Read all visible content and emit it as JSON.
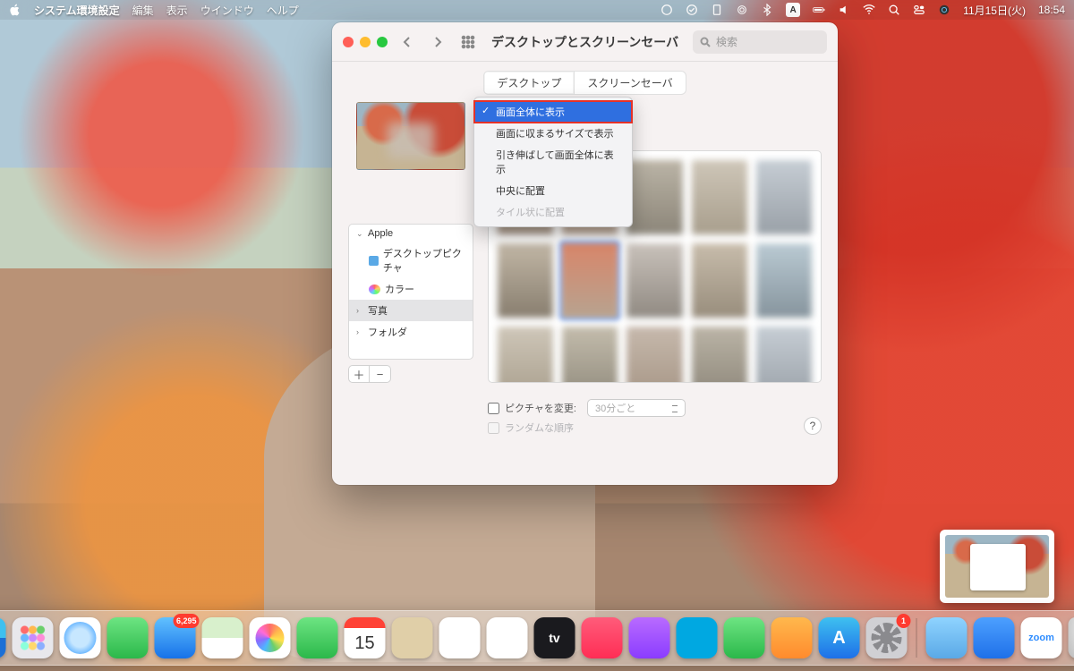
{
  "menubar": {
    "app": "システム環境設定",
    "items": [
      "編集",
      "表示",
      "ウインドウ",
      "ヘルプ"
    ],
    "date": "11月15日(火)",
    "time": "18:54",
    "ime": "A"
  },
  "window": {
    "title": "デスクトップとスクリーンセーバ",
    "search_placeholder": "検索",
    "tabs": {
      "desktop": "デスクトップ",
      "screensaver": "スクリーンセーバ",
      "active": "desktop"
    },
    "sidebar": {
      "apple": {
        "label": "Apple",
        "children": [
          {
            "label": "デスクトップピクチャ",
            "icon": "blue"
          },
          {
            "label": "カラー",
            "icon": "multi"
          }
        ]
      },
      "photos": {
        "label": "写真",
        "selected": true
      },
      "folders": {
        "label": "フォルダ"
      }
    },
    "scale_menu": {
      "options": [
        {
          "label": "画面全体に表示",
          "selected": true,
          "highlighted": true
        },
        {
          "label": "画面に収まるサイズで表示"
        },
        {
          "label": "引き伸ばして画面全体に表示"
        },
        {
          "label": "中央に配置"
        },
        {
          "label": "タイル状に配置",
          "disabled": true
        }
      ]
    },
    "footer": {
      "change_label": "ピクチャを変更:",
      "frequency": "30分ごと",
      "random_label": "ランダムな順序"
    },
    "help": "?"
  },
  "dock": {
    "calendar_day": "15",
    "mail_badge": "6,295",
    "sysprefs_badge": "1",
    "zoom_label": "zoom"
  }
}
